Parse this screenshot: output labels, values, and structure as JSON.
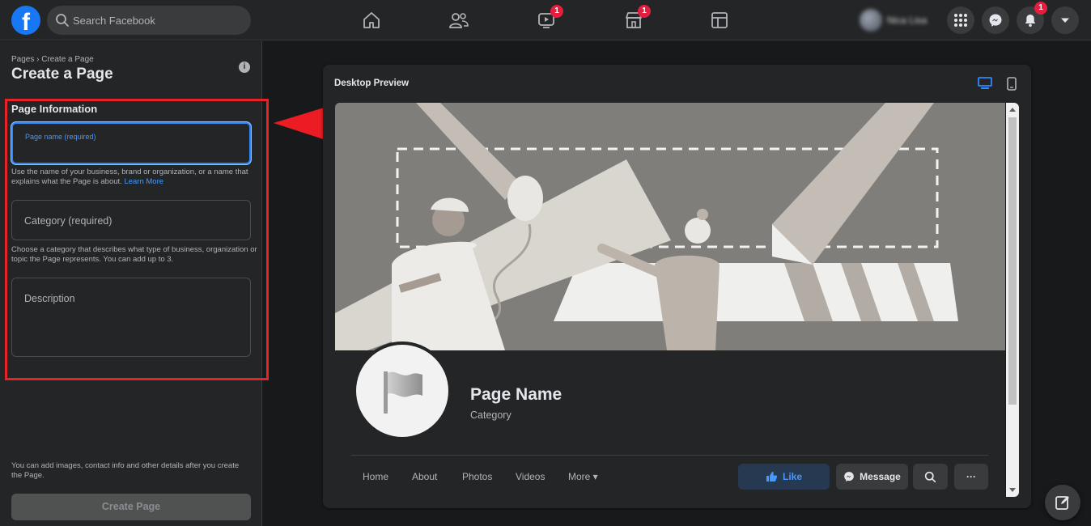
{
  "topbar": {
    "search_placeholder": "Search Facebook",
    "watch_badge": "1",
    "marketplace_badge": "1",
    "notifications_badge": "1",
    "profile_name": "Nica Lisa",
    "logo_letter": "f"
  },
  "left": {
    "breadcrumb": "Pages › Create a Page",
    "title": "Create a Page",
    "section_title": "Page Information",
    "page_name_label": "Page name (required)",
    "page_name_help": "Use the name of your business, brand or organization, or a name that explains what the Page is about.",
    "learn_more": "Learn More",
    "category_placeholder": "Category (required)",
    "category_help": "Choose a category that describes what type of business, organization or topic the Page represents. You can add up to 3.",
    "description_placeholder": "Description",
    "bottom_note": "You can add images, contact info and other details after you create the Page.",
    "create_button": "Create Page"
  },
  "preview": {
    "title": "Desktop Preview",
    "page_name": "Page Name",
    "category": "Category",
    "tabs": [
      "Home",
      "About",
      "Photos",
      "Videos",
      "More ▾"
    ],
    "like_button": "Like",
    "message_button": "Message",
    "more_button": "···"
  },
  "colors": {
    "accent": "#1877f2",
    "link": "#4599ff",
    "highlight": "#e5242a",
    "badge": "#e41e3f"
  },
  "icons": [
    "search-icon",
    "home-icon",
    "friends-icon",
    "watch-icon",
    "marketplace-icon",
    "groups-icon",
    "menu-grid-icon",
    "messenger-icon",
    "bell-icon",
    "caret-down-icon",
    "info-icon",
    "desktop-icon",
    "mobile-icon",
    "flag-icon",
    "thumbs-up-icon",
    "compose-icon"
  ]
}
